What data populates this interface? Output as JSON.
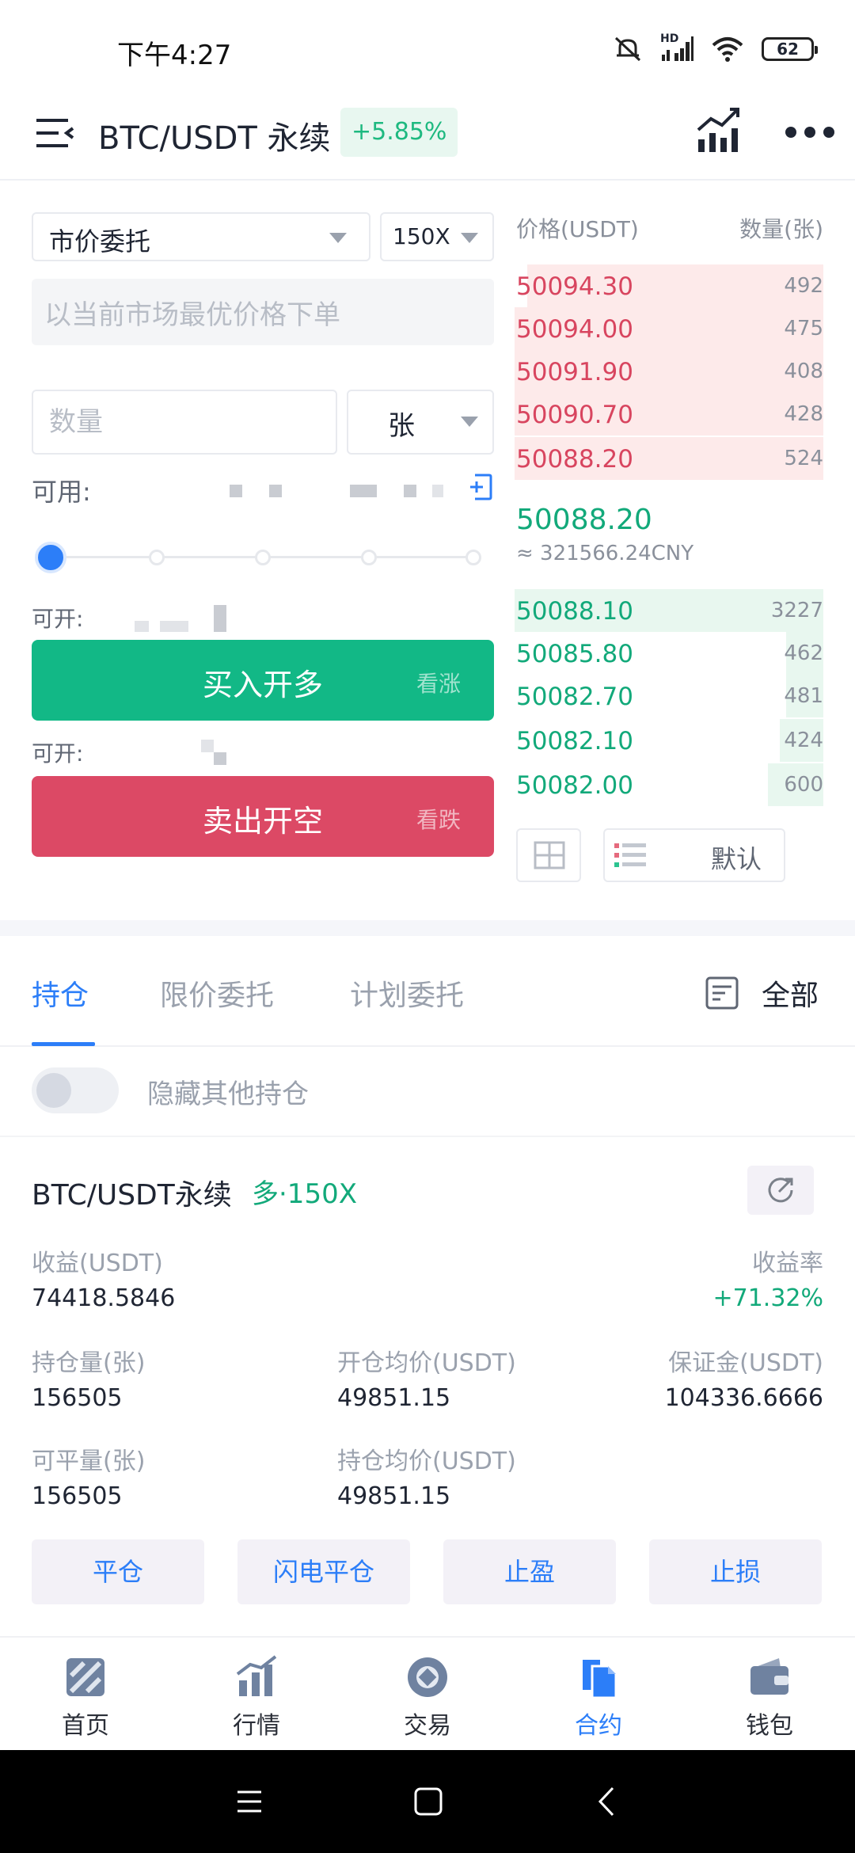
{
  "status_bar": {
    "time": "下午4:27",
    "network": "HD",
    "battery": "62"
  },
  "header": {
    "title": "BTC/USDT 永续",
    "change": "+5.85%"
  },
  "trade": {
    "order_type": "市价委托",
    "leverage": "150X",
    "market_hint": "以当前市场最优价格下单",
    "quantity_placeholder": "数量",
    "unit": "张",
    "available_label": "可用:",
    "open_long_label": "可开:",
    "open_short_label": "可开:",
    "buy_label": "买入开多",
    "buy_sub": "看涨",
    "sell_label": "卖出开空",
    "sell_sub": "看跌",
    "slider_percent": 0
  },
  "orderbook": {
    "price_header": "价格(USDT)",
    "qty_header": "数量(张)",
    "asks": [
      {
        "price": "50094.30",
        "qty": "492",
        "depth": 0.96
      },
      {
        "price": "50094.00",
        "qty": "475",
        "depth": 1.0
      },
      {
        "price": "50091.90",
        "qty": "408",
        "depth": 1.0
      },
      {
        "price": "50090.70",
        "qty": "428",
        "depth": 1.0
      },
      {
        "price": "50088.20",
        "qty": "524",
        "depth": 1.0
      }
    ],
    "last_price": "50088.20",
    "last_cny": "≈ 321566.24CNY",
    "bids": [
      {
        "price": "50088.10",
        "qty": "3227",
        "depth": 1.0
      },
      {
        "price": "50085.80",
        "qty": "462",
        "depth": 0.12
      },
      {
        "price": "50082.70",
        "qty": "481",
        "depth": 0.12
      },
      {
        "price": "50082.10",
        "qty": "424",
        "depth": 0.14
      },
      {
        "price": "50082.00",
        "qty": "600",
        "depth": 0.18
      }
    ],
    "depth_mode": "默认"
  },
  "tabs": [
    {
      "label": "持仓",
      "active": true
    },
    {
      "label": "限价委托",
      "active": false
    },
    {
      "label": "计划委托",
      "active": false
    }
  ],
  "filter_all": "全部",
  "hide_others_label": "隐藏其他持仓",
  "position": {
    "symbol": "BTC/USDT永续",
    "side": "多·150X",
    "pnl_label": "收益(USDT)",
    "pnl_value": "74418.5846",
    "roe_label": "收益率",
    "roe_value": "+71.32%",
    "size_label": "持仓量(张)",
    "size_value": "156505",
    "entry_label": "开仓均价(USDT)",
    "entry_value": "49851.15",
    "margin_label": "保证金(USDT)",
    "margin_value": "104336.6666",
    "closable_label": "可平量(张)",
    "closable_value": "156505",
    "avg_label": "持仓均价(USDT)",
    "avg_value": "49851.15"
  },
  "actions": {
    "close": "平仓",
    "flash_close": "闪电平仓",
    "take_profit": "止盈",
    "stop_loss": "止损"
  },
  "nav": [
    {
      "label": "首页",
      "icon": "home-icon"
    },
    {
      "label": "行情",
      "icon": "market-chart-icon"
    },
    {
      "label": "交易",
      "icon": "trade-coin-icon"
    },
    {
      "label": "合约",
      "icon": "contract-icon"
    },
    {
      "label": "钱包",
      "icon": "wallet-icon"
    }
  ],
  "colors": {
    "accent": "#2c7ef8",
    "buy": "#12b886",
    "sell": "#dc4965",
    "ask_text": "#d8455f",
    "bid_text": "#12a97a"
  }
}
